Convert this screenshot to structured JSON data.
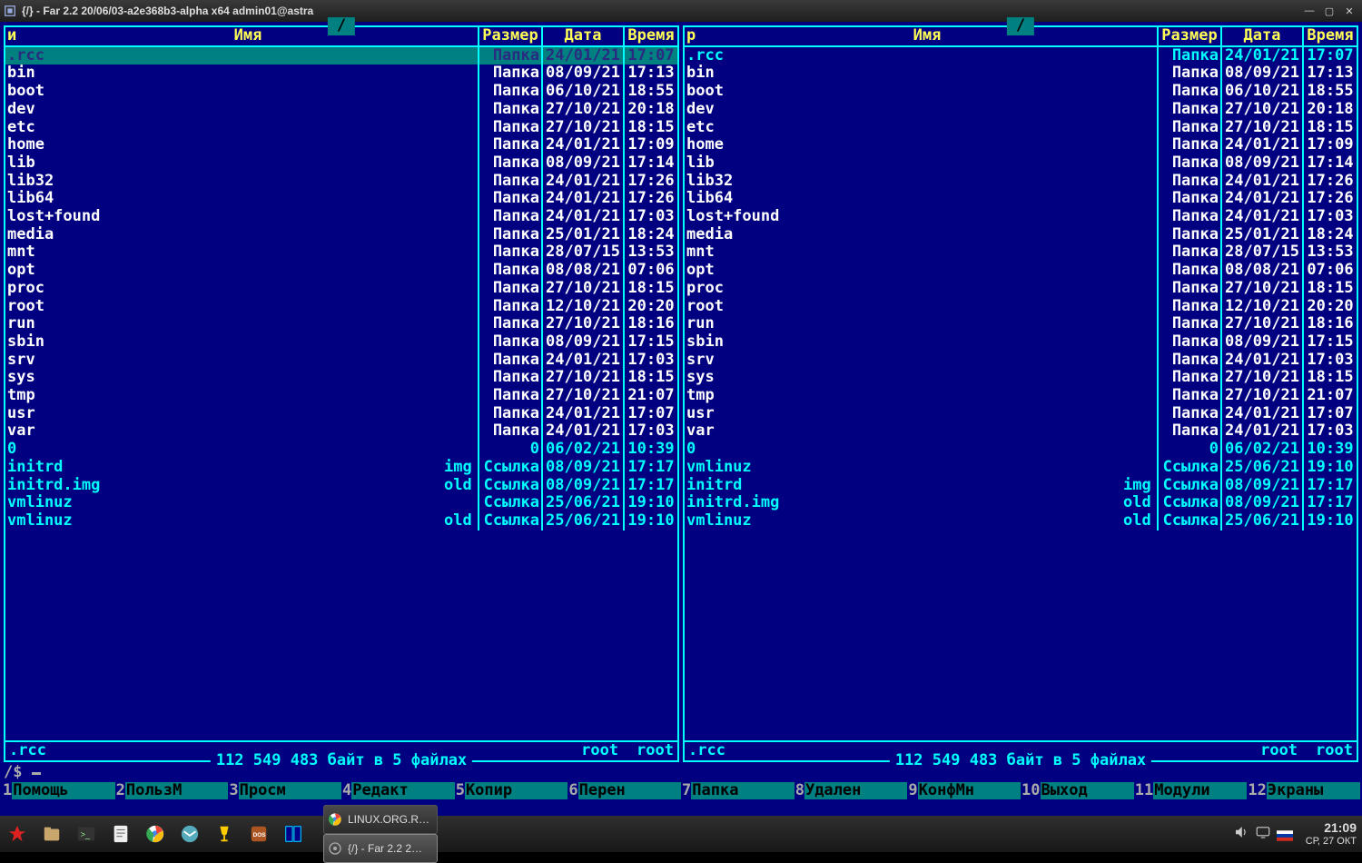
{
  "window": {
    "title": "{/} - Far 2.2 20/06/03-a2e368b3-alpha x64 admin01@astra"
  },
  "panels": {
    "left": {
      "path": "/",
      "sort": "и",
      "headers": {
        "name": "Имя",
        "size": "Размер",
        "date": "Дата",
        "time": "Время"
      },
      "rows": [
        {
          "name": ".rcc",
          "ext": "",
          "size": "Папка",
          "date": "24/01/21",
          "time": "17:07",
          "selected": true,
          "type": "dir"
        },
        {
          "name": "bin",
          "ext": "",
          "size": "Папка",
          "date": "08/09/21",
          "time": "17:13",
          "type": "dir"
        },
        {
          "name": "boot",
          "ext": "",
          "size": "Папка",
          "date": "06/10/21",
          "time": "18:55",
          "type": "dir"
        },
        {
          "name": "dev",
          "ext": "",
          "size": "Папка",
          "date": "27/10/21",
          "time": "20:18",
          "type": "dir"
        },
        {
          "name": "etc",
          "ext": "",
          "size": "Папка",
          "date": "27/10/21",
          "time": "18:15",
          "type": "dir"
        },
        {
          "name": "home",
          "ext": "",
          "size": "Папка",
          "date": "24/01/21",
          "time": "17:09",
          "type": "dir"
        },
        {
          "name": "lib",
          "ext": "",
          "size": "Папка",
          "date": "08/09/21",
          "time": "17:14",
          "type": "dir"
        },
        {
          "name": "lib32",
          "ext": "",
          "size": "Папка",
          "date": "24/01/21",
          "time": "17:26",
          "type": "dir"
        },
        {
          "name": "lib64",
          "ext": "",
          "size": "Папка",
          "date": "24/01/21",
          "time": "17:26",
          "type": "dir"
        },
        {
          "name": "lost+found",
          "ext": "",
          "size": "Папка",
          "date": "24/01/21",
          "time": "17:03",
          "type": "dir"
        },
        {
          "name": "media",
          "ext": "",
          "size": "Папка",
          "date": "25/01/21",
          "time": "18:24",
          "type": "dir"
        },
        {
          "name": "mnt",
          "ext": "",
          "size": "Папка",
          "date": "28/07/15",
          "time": "13:53",
          "type": "dir"
        },
        {
          "name": "opt",
          "ext": "",
          "size": "Папка",
          "date": "08/08/21",
          "time": "07:06",
          "type": "dir"
        },
        {
          "name": "proc",
          "ext": "",
          "size": "Папка",
          "date": "27/10/21",
          "time": "18:15",
          "type": "dir"
        },
        {
          "name": "root",
          "ext": "",
          "size": "Папка",
          "date": "12/10/21",
          "time": "20:20",
          "type": "dir"
        },
        {
          "name": "run",
          "ext": "",
          "size": "Папка",
          "date": "27/10/21",
          "time": "18:16",
          "type": "dir"
        },
        {
          "name": "sbin",
          "ext": "",
          "size": "Папка",
          "date": "08/09/21",
          "time": "17:15",
          "type": "dir"
        },
        {
          "name": "srv",
          "ext": "",
          "size": "Папка",
          "date": "24/01/21",
          "time": "17:03",
          "type": "dir"
        },
        {
          "name": "sys",
          "ext": "",
          "size": "Папка",
          "date": "27/10/21",
          "time": "18:15",
          "type": "dir"
        },
        {
          "name": "tmp",
          "ext": "",
          "size": "Папка",
          "date": "27/10/21",
          "time": "21:07",
          "type": "dir"
        },
        {
          "name": "usr",
          "ext": "",
          "size": "Папка",
          "date": "24/01/21",
          "time": "17:07",
          "type": "dir"
        },
        {
          "name": "var",
          "ext": "",
          "size": "Папка",
          "date": "24/01/21",
          "time": "17:03",
          "type": "dir"
        },
        {
          "name": "0",
          "ext": "",
          "size": "0",
          "date": "06/02/21",
          "time": "10:39",
          "type": "file"
        },
        {
          "name": "initrd",
          "ext": "img",
          "size": "Ссылка",
          "date": "08/09/21",
          "time": "17:17",
          "type": "file"
        },
        {
          "name": "initrd.img",
          "ext": "old",
          "size": "Ссылка",
          "date": "08/09/21",
          "time": "17:17",
          "type": "file"
        },
        {
          "name": "vmlinuz",
          "ext": "",
          "size": "Ссылка",
          "date": "25/06/21",
          "time": "19:10",
          "type": "file"
        },
        {
          "name": "vmlinuz",
          "ext": "old",
          "size": "Ссылка",
          "date": "25/06/21",
          "time": "19:10",
          "type": "file"
        }
      ],
      "footer": {
        "current": ".rcc",
        "owner": "root",
        "group": "root"
      },
      "status": " 112 549 483 байт в 5 файлах "
    },
    "right": {
      "path": "/",
      "sort": "р",
      "headers": {
        "name": "Имя",
        "size": "Размер",
        "date": "Дата",
        "time": "Время"
      },
      "rows": [
        {
          "name": ".rcc",
          "ext": "",
          "size": "Папка",
          "date": "24/01/21",
          "time": "17:07",
          "type": "file"
        },
        {
          "name": "bin",
          "ext": "",
          "size": "Папка",
          "date": "08/09/21",
          "time": "17:13",
          "type": "dir"
        },
        {
          "name": "boot",
          "ext": "",
          "size": "Папка",
          "date": "06/10/21",
          "time": "18:55",
          "type": "dir"
        },
        {
          "name": "dev",
          "ext": "",
          "size": "Папка",
          "date": "27/10/21",
          "time": "20:18",
          "type": "dir"
        },
        {
          "name": "etc",
          "ext": "",
          "size": "Папка",
          "date": "27/10/21",
          "time": "18:15",
          "type": "dir"
        },
        {
          "name": "home",
          "ext": "",
          "size": "Папка",
          "date": "24/01/21",
          "time": "17:09",
          "type": "dir"
        },
        {
          "name": "lib",
          "ext": "",
          "size": "Папка",
          "date": "08/09/21",
          "time": "17:14",
          "type": "dir"
        },
        {
          "name": "lib32",
          "ext": "",
          "size": "Папка",
          "date": "24/01/21",
          "time": "17:26",
          "type": "dir"
        },
        {
          "name": "lib64",
          "ext": "",
          "size": "Папка",
          "date": "24/01/21",
          "time": "17:26",
          "type": "dir"
        },
        {
          "name": "lost+found",
          "ext": "",
          "size": "Папка",
          "date": "24/01/21",
          "time": "17:03",
          "type": "dir"
        },
        {
          "name": "media",
          "ext": "",
          "size": "Папка",
          "date": "25/01/21",
          "time": "18:24",
          "type": "dir"
        },
        {
          "name": "mnt",
          "ext": "",
          "size": "Папка",
          "date": "28/07/15",
          "time": "13:53",
          "type": "dir"
        },
        {
          "name": "opt",
          "ext": "",
          "size": "Папка",
          "date": "08/08/21",
          "time": "07:06",
          "type": "dir"
        },
        {
          "name": "proc",
          "ext": "",
          "size": "Папка",
          "date": "27/10/21",
          "time": "18:15",
          "type": "dir"
        },
        {
          "name": "root",
          "ext": "",
          "size": "Папка",
          "date": "12/10/21",
          "time": "20:20",
          "type": "dir"
        },
        {
          "name": "run",
          "ext": "",
          "size": "Папка",
          "date": "27/10/21",
          "time": "18:16",
          "type": "dir"
        },
        {
          "name": "sbin",
          "ext": "",
          "size": "Папка",
          "date": "08/09/21",
          "time": "17:15",
          "type": "dir"
        },
        {
          "name": "srv",
          "ext": "",
          "size": "Папка",
          "date": "24/01/21",
          "time": "17:03",
          "type": "dir"
        },
        {
          "name": "sys",
          "ext": "",
          "size": "Папка",
          "date": "27/10/21",
          "time": "18:15",
          "type": "dir"
        },
        {
          "name": "tmp",
          "ext": "",
          "size": "Папка",
          "date": "27/10/21",
          "time": "21:07",
          "type": "dir"
        },
        {
          "name": "usr",
          "ext": "",
          "size": "Папка",
          "date": "24/01/21",
          "time": "17:07",
          "type": "dir"
        },
        {
          "name": "var",
          "ext": "",
          "size": "Папка",
          "date": "24/01/21",
          "time": "17:03",
          "type": "dir"
        },
        {
          "name": "0",
          "ext": "",
          "size": "0",
          "date": "06/02/21",
          "time": "10:39",
          "type": "file"
        },
        {
          "name": "vmlinuz",
          "ext": "",
          "size": "Ссылка",
          "date": "25/06/21",
          "time": "19:10",
          "type": "file"
        },
        {
          "name": "initrd",
          "ext": "img",
          "size": "Ссылка",
          "date": "08/09/21",
          "time": "17:17",
          "type": "file"
        },
        {
          "name": "initrd.img",
          "ext": "old",
          "size": "Ссылка",
          "date": "08/09/21",
          "time": "17:17",
          "type": "file"
        },
        {
          "name": "vmlinuz",
          "ext": "old",
          "size": "Ссылка",
          "date": "25/06/21",
          "time": "19:10",
          "type": "file"
        }
      ],
      "footer": {
        "current": ".rcc",
        "owner": "root",
        "group": "root"
      },
      "status": " 112 549 483 байт в 5 файлах "
    }
  },
  "cmdline": {
    "prompt": "/$ "
  },
  "keybar": [
    {
      "n": "1",
      "l": "Помощь"
    },
    {
      "n": "2",
      "l": "ПользМ"
    },
    {
      "n": "3",
      "l": "Просм"
    },
    {
      "n": "4",
      "l": "Редакт"
    },
    {
      "n": "5",
      "l": "Копир"
    },
    {
      "n": "6",
      "l": "Перен"
    },
    {
      "n": "7",
      "l": "Папка"
    },
    {
      "n": "8",
      "l": "Удален"
    },
    {
      "n": "9",
      "l": "КонфМн"
    },
    {
      "n": "10",
      "l": "Выход"
    },
    {
      "n": "11",
      "l": "Модули"
    },
    {
      "n": "12",
      "l": "Экраны"
    }
  ],
  "taskbar": {
    "items": [
      {
        "label": "LINUX.ORG.R…",
        "icon": "chrome",
        "active": false
      },
      {
        "label": "{/} - Far 2.2 2…",
        "icon": "gear",
        "active": true
      }
    ],
    "clock": {
      "time": "21:09",
      "date": "СР, 27 ОКТ"
    }
  }
}
